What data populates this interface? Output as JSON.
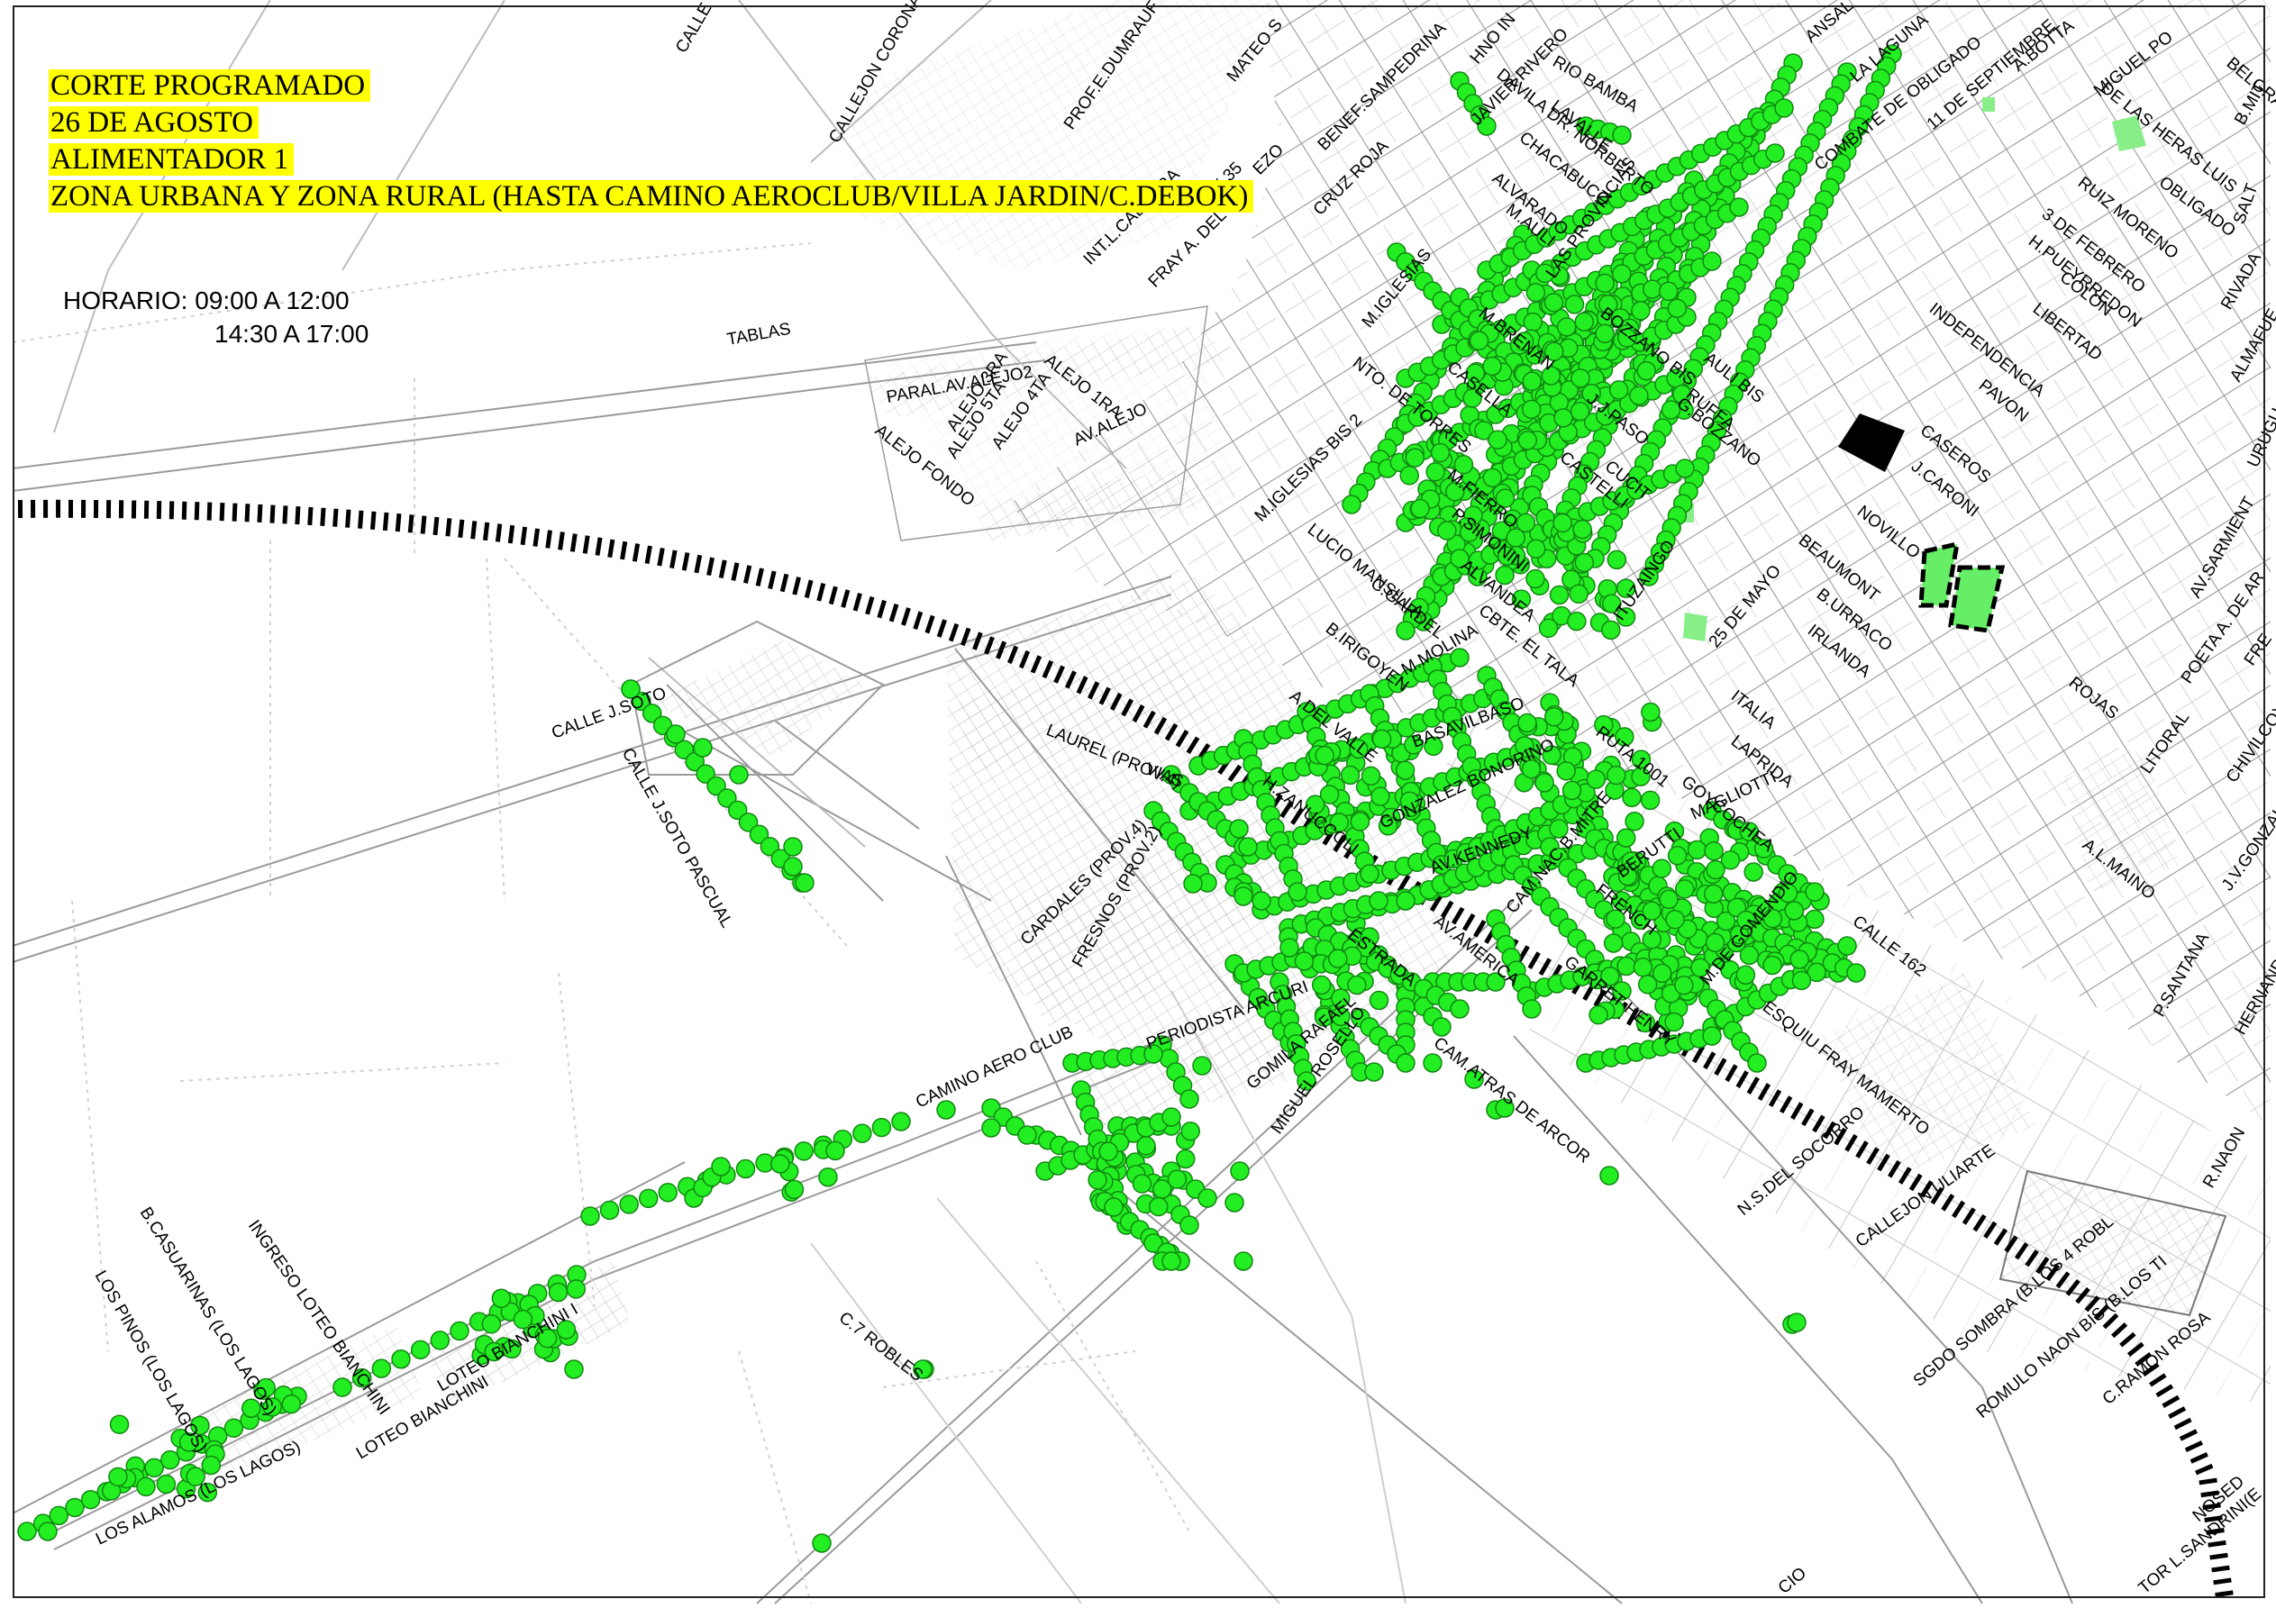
{
  "header": {
    "line1": "CORTE PROGRAMADO",
    "line2": "26 DE AGOSTO",
    "line3": "ALIMENTADOR 1",
    "line4": "ZONA URBANA Y ZONA RURAL (HASTA CAMINO AEROCLUB/VILLA JARDIN/C.DEBOK)"
  },
  "schedule": {
    "label": "HORARIO: 09:00 A 12:00",
    "label2": "14:30 A 17:00"
  },
  "colors": {
    "affected_point": "#22ee22",
    "affected_edge": "#118811",
    "highlight": "#ffff00",
    "railway": "#000000",
    "street": "#b0b0b0"
  },
  "legend_meaning": "",
  "streets": [
    "CALLE",
    "CALLEJON CORONA",
    "PROF.E.DUMRAUF",
    "MATEO S",
    "BENEF.SAMPEDRINA",
    "HNO IN",
    "DAVILA DR. NORBERTO",
    "JAVIER RIVERO",
    "RIO BAMBA",
    "ANSAL",
    "LA LAGUNA",
    "COMBATE DE OBLIGADO",
    "11 DE SEPTIEMBRE",
    "A.BOTTA",
    "MIGUEL PO",
    "BELGRA",
    "B.MIT",
    "DE LAS HERAS LUIS",
    "OBLIGADO",
    "SALT",
    "RUIZ MORENO",
    "3 DE FEBRERO",
    "H.PUEYRREDON",
    "RIVADA",
    "COLON",
    "LIBERTAD",
    "ALMAFUE",
    "INDEPENDENCIA",
    "PAVON",
    "CASEROS",
    "J.CARONI",
    "URUGU",
    "NOVILLO",
    "AV.SARMIENT",
    "BEAUMONT",
    "POETA A. DE AR",
    "B.URRACO",
    "ROJAS",
    "IRLANDA",
    "FRE",
    "LITORAL",
    "CHIVILCOY",
    "ITALIA",
    "LAPRIDA",
    "A.L.MAINO",
    "J.V.GONZALE",
    "GOYCOCHEA",
    "CALLE 162",
    "P.SANTANA",
    "HERNANDEZ J",
    "R.NAON",
    "LAVALLE",
    "CHACABUCO",
    "ALVARADO",
    "CRUZ ROJA",
    "INT.L.CABRERA",
    "X 35",
    "FRAY A. DEL",
    "EZO",
    "M.AULI",
    "LAS PROVINCIAS",
    "M.IGLESIAS",
    "M.BRENAN",
    "BOZZANO BIS",
    "AULI BIS",
    "RUFFA",
    "CASELLA",
    "J.J.PASO",
    "G.BOZZANO",
    "NTO. DE TORRES",
    "CASTELLI",
    "M.IGLESIAS BIS 2",
    "M.FIERRO",
    "CUCIT",
    "LUCIO MANSILLA",
    "P.SIMONINI",
    "ALVANDEA",
    "ITUZAINGO",
    "25 DE MAYO",
    "CBTE. EL TALA",
    "C.GARDEL",
    "B.IRIGOYEN",
    "M.MOLINA",
    "A.DEL VALLE",
    "BASAVILBASO",
    "RUTA 1001",
    "GONZALEZ BONORINO",
    "H.ZANUCCOLI",
    "MAGLIOTTI",
    "AV.KENNEDY",
    "CAM.NAC.B.MITRE",
    "BERUTTI",
    "FRENCH",
    "M.DE GOMENDIO",
    "AV.AMERICA",
    "GARRET HENRY",
    "ESQUIU FRAY MAMERTO",
    "LAURELES (PROV.4)",
    "VIAS",
    "CARDALES (PROV.4)",
    "FRESNOS (PROV.2)",
    "ESTRADA",
    "PERIODISTA ARCURI",
    "GOMILA RAFAEL",
    "MIGUEL ROSELLO",
    "CAM.ATRAS DE ARCOR",
    "CAMINO AERO CLUB",
    "N.S.DEL SOCORRO",
    "CALLEJON ULIARTE",
    "SGDO SOMBRA (B.LOS 4 ROBL",
    "ROMULO NAON BIS (B.LOS TI",
    "C.RAMON ROSA",
    "NOSED",
    "TOR L.SANDRINI(E",
    "CIO",
    "TABLAS",
    "PARAL.AV.ALEJO2",
    "ALEJO 1RA",
    "ALEJO 3RA",
    "ALEJO 4TA",
    "ALEJO 5TA",
    "AV.ALEJO",
    "ALEJO FONDO",
    "CALLE J.SOTO",
    "CALLE J.SOTO PASCUAL",
    "B.CASUARINAS (LOS LAGOS)",
    "LOS PINOS (LOS LAGOS)",
    "INGRESO LOTEO BIANCHINI",
    "LOTEO BIANCHINI",
    "LOTEO BIANCHINI I",
    "LOS ALAMOS (LOS LAGOS)",
    "C.7 ROBLES"
  ]
}
